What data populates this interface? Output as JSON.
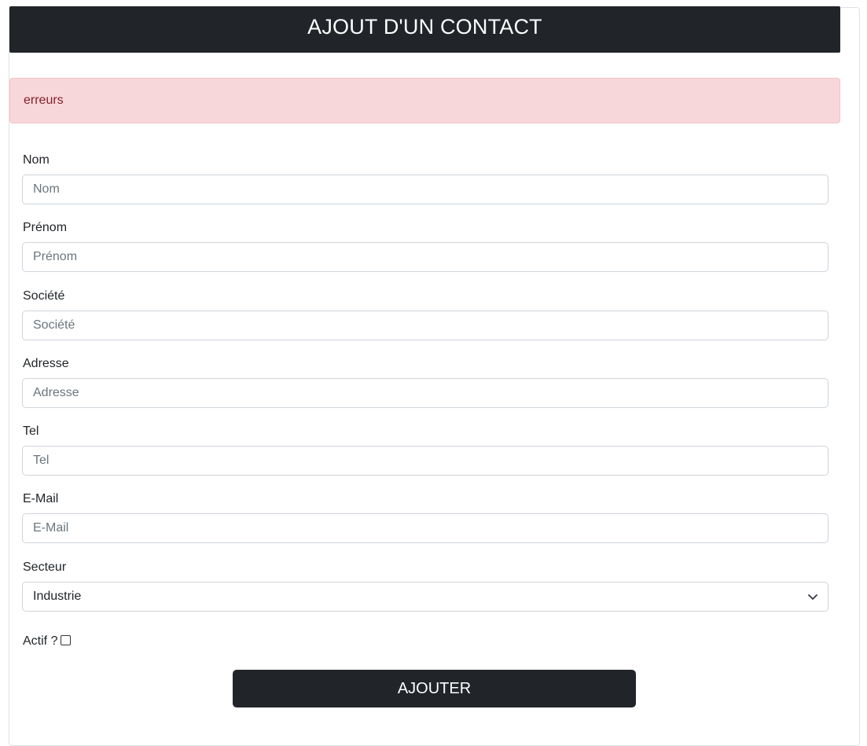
{
  "header": {
    "title": "AJOUT D'UN CONTACT"
  },
  "alert": {
    "text": "erreurs"
  },
  "form": {
    "fields": [
      {
        "label": "Nom",
        "placeholder": "Nom",
        "value": ""
      },
      {
        "label": "Prénom",
        "placeholder": "Prénom",
        "value": ""
      },
      {
        "label": "Société",
        "placeholder": "Société",
        "value": ""
      },
      {
        "label": "Adresse",
        "placeholder": "Adresse",
        "value": ""
      },
      {
        "label": "Tel",
        "placeholder": "Tel",
        "value": ""
      },
      {
        "label": "E-Mail",
        "placeholder": "E-Mail",
        "value": ""
      }
    ],
    "secteur": {
      "label": "Secteur",
      "selected": "Industrie"
    },
    "actif": {
      "label": "Actif ?",
      "checked": false
    },
    "submit_label": "AJOUTER"
  },
  "icons": {
    "select_arrow": "chevron-down-icon"
  },
  "colors": {
    "header_bg": "#212529",
    "alert_bg": "#f8d7da",
    "alert_text": "#842029",
    "button_bg": "#212529"
  }
}
